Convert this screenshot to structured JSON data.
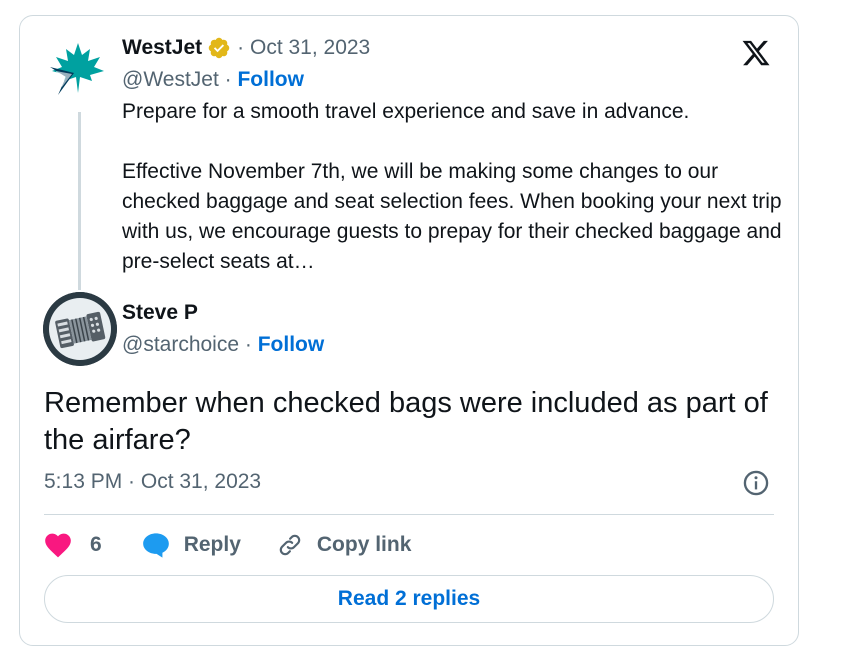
{
  "parent_tweet": {
    "author_name": "WestJet",
    "verified_icon": "verified-gold-badge-icon",
    "date": "· Oct 31, 2023",
    "handle": "@WestJet",
    "separator": " · ",
    "follow_label": "Follow",
    "body_line1": "Prepare for a smooth travel experience and save in advance.",
    "body_line2": "Effective November 7th, we will be making some changes to our checked baggage and seat selection fees. When booking your next trip with us, we encourage guests to prepay for their checked baggage and pre-select seats at…",
    "avatar_icon": "westjet-logo-icon"
  },
  "reply_tweet": {
    "author_name": "Steve P",
    "handle": "@starchoice",
    "separator": " · ",
    "follow_label": "Follow",
    "text": "Remember when checked bags were included as part of the airfare?",
    "timestamp": "5:13 PM · Oct 31, 2023",
    "avatar_icon": "accordion-avatar-icon"
  },
  "actions": {
    "like_count": "6",
    "reply_label": "Reply",
    "copy_link_label": "Copy link"
  },
  "read_replies_label": "Read 2 replies",
  "colors": {
    "link_blue": "#006fd6",
    "like_pink": "#f91880",
    "reply_blue": "#1d9bf0",
    "verified_gold": "#e2b719",
    "westjet_teal": "#00a1a0",
    "border": "#cfd9de",
    "muted_text": "#536471"
  }
}
